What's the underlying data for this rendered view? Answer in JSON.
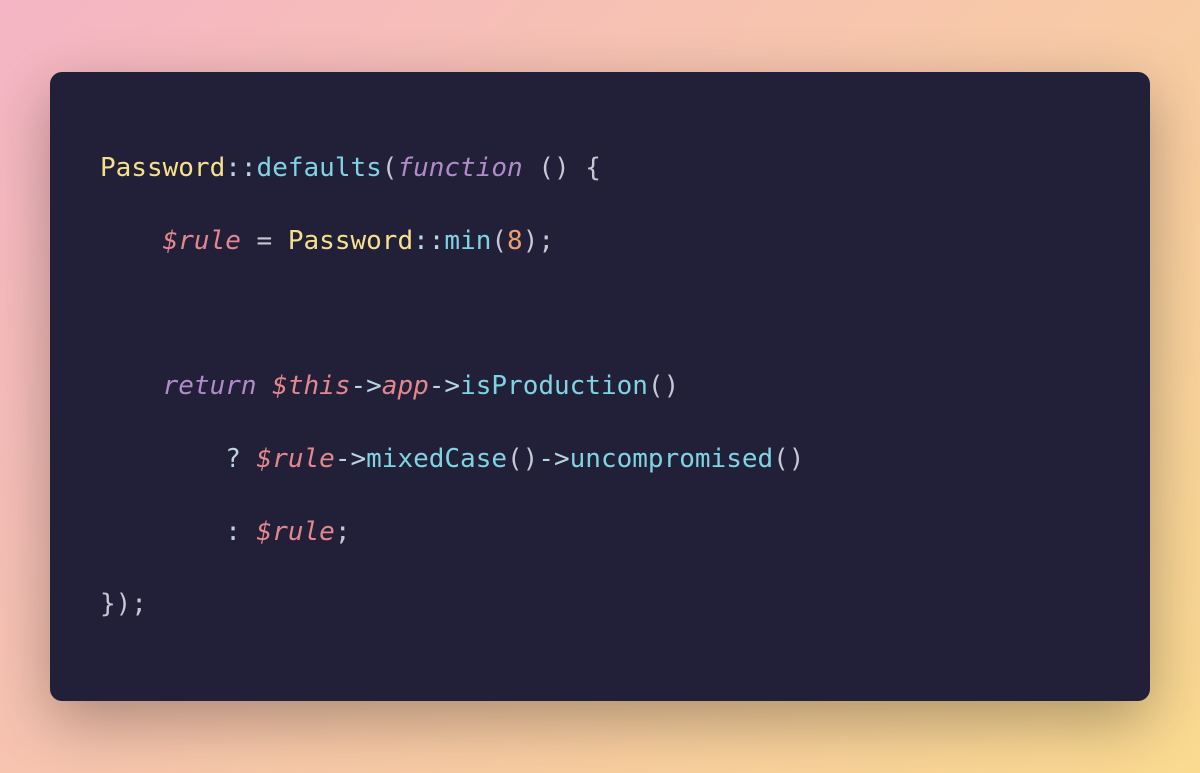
{
  "code": {
    "line1": {
      "class1": "Password",
      "dblcolon1": "::",
      "fn1": "defaults",
      "paren1": "(",
      "kw1": "function ",
      "paren2": "()",
      "brace1": " {"
    },
    "line2": {
      "indent": "    ",
      "var1": "$rule",
      "eq": " = ",
      "class2": "Password",
      "dblcolon2": "::",
      "fn2": "min",
      "paren3": "(",
      "num": "8",
      "paren4": ")",
      "semi1": ";"
    },
    "line3": {
      "indent": "    ",
      "kw2": "return ",
      "this": "$this",
      "arrow1": "->",
      "prop1": "app",
      "arrow2": "->",
      "fn3": "isProduction",
      "paren5": "()"
    },
    "line4": {
      "indent": "        ",
      "tern1": "? ",
      "var2": "$rule",
      "arrow3": "->",
      "fn4": "mixedCase",
      "paren6": "()",
      "arrow4": "->",
      "fn5": "uncompromised",
      "paren7": "()"
    },
    "line5": {
      "indent": "        ",
      "tern2": ": ",
      "var3": "$rule",
      "semi2": ";"
    },
    "line6": {
      "close": "});"
    }
  }
}
